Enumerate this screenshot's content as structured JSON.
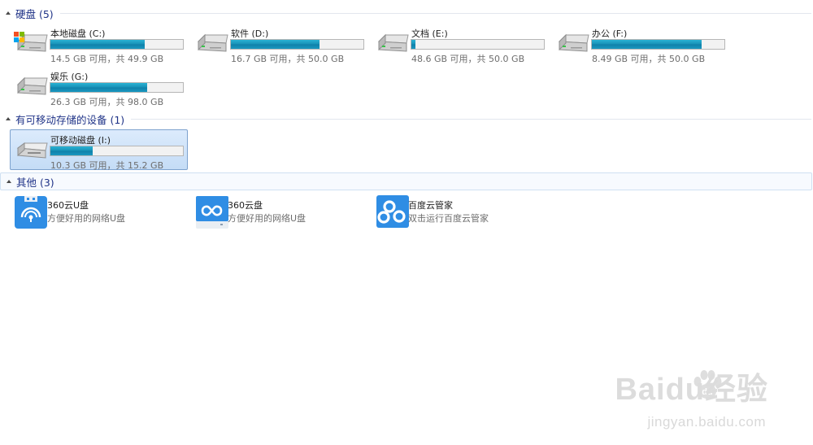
{
  "groups": {
    "hard_disks": {
      "title": "硬盘 (5)"
    },
    "removable": {
      "title": "有可移动存储的设备 (1)"
    },
    "other": {
      "title": "其他 (3)"
    }
  },
  "drives": [
    {
      "name": "本地磁盘 (C:)",
      "size": "14.5 GB 可用，共 49.9 GB",
      "used_fraction": 0.709,
      "system": true
    },
    {
      "name": "软件 (D:)",
      "size": "16.7 GB 可用，共 50.0 GB",
      "used_fraction": 0.666,
      "system": false
    },
    {
      "name": "文档 (E:)",
      "size": "48.6 GB 可用，共 50.0 GB",
      "used_fraction": 0.028,
      "system": false
    },
    {
      "name": "办公 (F:)",
      "size": "8.49 GB 可用，共 50.0 GB",
      "used_fraction": 0.83,
      "system": false
    },
    {
      "name": "娱乐 (G:)",
      "size": "26.3 GB 可用，共 98.0 GB",
      "used_fraction": 0.732,
      "system": false
    }
  ],
  "removable_drives": [
    {
      "name": "可移动磁盘 (I:)",
      "size": "10.3 GB 可用，共 15.2 GB",
      "used_fraction": 0.322,
      "selected": true
    }
  ],
  "other_items": [
    {
      "name": "360云U盘",
      "desc": "方便好用的网络U盘",
      "icon": "360-cloud-usb-icon"
    },
    {
      "name": "360云盘",
      "desc": "方便好用的网络U盘",
      "icon": "360-cloud-disk-icon"
    },
    {
      "name": "百度云管家",
      "desc": "双击运行百度云管家",
      "icon": "baidu-cloud-icon"
    }
  ],
  "watermark": {
    "brand": "Baidu经验",
    "url": "jingyan.baidu.com"
  },
  "colors": {
    "group_title": "#1e3287",
    "bar_fill": "#1a98c0",
    "selection_bg": "#cfe3f8",
    "selection_border": "#7da2ce",
    "app_icon_blue": "#2f8de4"
  }
}
